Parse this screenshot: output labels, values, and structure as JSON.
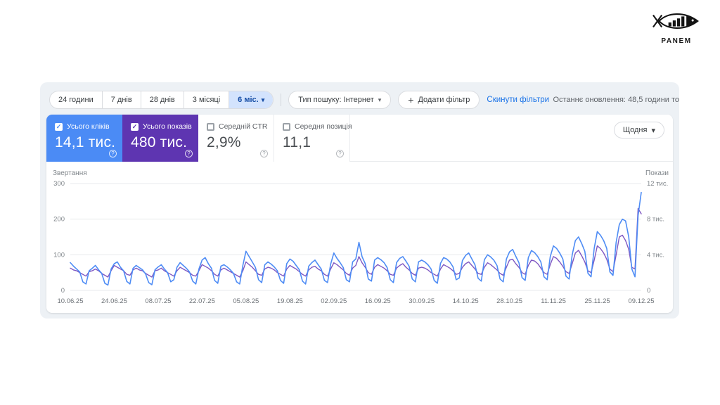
{
  "logo": {
    "brand": "PANEM"
  },
  "icons": {
    "chevron_down": "▾",
    "plus": "+",
    "check": "✓",
    "help": "?"
  },
  "toolbar": {
    "ranges": [
      {
        "label": "24 години",
        "selected": false
      },
      {
        "label": "7 днів",
        "selected": false
      },
      {
        "label": "28 днів",
        "selected": false
      },
      {
        "label": "3 місяці",
        "selected": false
      },
      {
        "label": "6 міс.",
        "selected": true
      }
    ],
    "search_type": "Тип пошуку: Інтернет",
    "add_filter": "Додати фільтр",
    "reset_filters": "Скинути фільтри",
    "last_update": "Останнє оновлення: 48,5 години то"
  },
  "metrics": {
    "granularity": "Щодня",
    "cards": [
      {
        "label": "Усього кліків",
        "value": "14,1 тис.",
        "checked": true,
        "color": "#4b8bf5"
      },
      {
        "label": "Усього показів",
        "value": "480 тис.",
        "checked": true,
        "color": "#5e35b1"
      },
      {
        "label": "Середній CTR",
        "value": "2,9%",
        "checked": false,
        "color": ""
      },
      {
        "label": "Середня позиція",
        "value": "11,1",
        "checked": false,
        "color": ""
      }
    ]
  },
  "chart_data": {
    "type": "line",
    "title": "",
    "grid": true,
    "legend_position": "none",
    "y_left": {
      "label": "Звертання",
      "ticks": [
        "300",
        "200",
        "100",
        "0"
      ],
      "max": 300
    },
    "y_right": {
      "label": "Покази",
      "ticks": [
        "12 тис.",
        "8 тис.",
        "4 тис.",
        "0"
      ],
      "max": 12
    },
    "x_tick_labels": [
      "10.06.25",
      "24.06.25",
      "08.07.25",
      "22.07.25",
      "05.08.25",
      "19.08.25",
      "02.09.25",
      "16.09.25",
      "30.09.25",
      "14.10.25",
      "28.10.25",
      "11.11.25",
      "25.11.25",
      "09.12.25"
    ],
    "series": [
      {
        "name": "Усього кліків",
        "axis": "left",
        "color": "#4e8cf5",
        "values": [
          78,
          68,
          60,
          52,
          24,
          18,
          55,
          62,
          70,
          58,
          48,
          20,
          15,
          60,
          75,
          80,
          65,
          55,
          25,
          18,
          62,
          70,
          64,
          58,
          46,
          22,
          16,
          58,
          66,
          72,
          60,
          50,
          24,
          30,
          65,
          78,
          70,
          62,
          52,
          26,
          18,
          60,
          85,
          92,
          75,
          62,
          28,
          20,
          68,
          72,
          66,
          58,
          48,
          24,
          18,
          70,
          110,
          95,
          80,
          65,
          30,
          22,
          72,
          80,
          74,
          66,
          55,
          28,
          20,
          75,
          88,
          82,
          70,
          58,
          26,
          18,
          68,
          78,
          85,
          72,
          60,
          28,
          22,
          74,
          105,
          90,
          78,
          64,
          30,
          24,
          80,
          88,
          135,
          95,
          75,
          32,
          26,
          85,
          92,
          86,
          78,
          64,
          30,
          22,
          78,
          90,
          95,
          82,
          68,
          32,
          24,
          80,
          85,
          80,
          72,
          60,
          28,
          20,
          76,
          92,
          88,
          80,
          66,
          30,
          35,
          84,
          98,
          105,
          88,
          72,
          34,
          26,
          86,
          100,
          94,
          85,
          70,
          32,
          24,
          88,
          108,
          115,
          96,
          78,
          36,
          28,
          92,
          112,
          106,
          95,
          80,
          38,
          30,
          95,
          125,
          118,
          105,
          88,
          40,
          32,
          100,
          140,
          150,
          132,
          110,
          48,
          38,
          118,
          165,
          155,
          140,
          118,
          52,
          42,
          135,
          185,
          200,
          195,
          150,
          60,
          38,
          210,
          275
        ]
      },
      {
        "name": "Усього показів (тис.)",
        "axis": "right",
        "color": "#7e57c2",
        "values": [
          2.5,
          2.3,
          2.2,
          2.0,
          1.8,
          1.6,
          2.1,
          2.2,
          2.4,
          2.2,
          1.9,
          1.7,
          1.5,
          2.2,
          2.8,
          2.6,
          2.4,
          2.2,
          1.8,
          1.7,
          2.3,
          2.5,
          2.3,
          2.2,
          1.9,
          1.7,
          1.5,
          2.2,
          2.3,
          2.5,
          2.2,
          2.0,
          1.8,
          1.6,
          2.2,
          2.6,
          2.4,
          2.2,
          2.0,
          1.7,
          1.6,
          2.2,
          2.9,
          2.7,
          2.5,
          2.2,
          1.8,
          1.6,
          2.3,
          2.5,
          2.3,
          2.1,
          1.9,
          1.7,
          1.5,
          2.2,
          3.2,
          2.9,
          2.6,
          2.2,
          1.8,
          1.7,
          2.4,
          2.6,
          2.5,
          2.3,
          2.0,
          1.8,
          1.6,
          2.4,
          2.8,
          2.6,
          2.4,
          2.1,
          1.8,
          1.6,
          2.3,
          2.6,
          2.7,
          2.4,
          2.2,
          1.8,
          1.6,
          2.4,
          3.1,
          2.9,
          2.6,
          2.3,
          1.9,
          1.7,
          2.5,
          2.8,
          3.8,
          3.1,
          2.6,
          2.0,
          1.8,
          2.6,
          2.9,
          2.7,
          2.5,
          2.2,
          1.8,
          1.7,
          2.5,
          2.8,
          3.0,
          2.6,
          2.3,
          1.9,
          1.7,
          2.5,
          2.6,
          2.5,
          2.3,
          2.0,
          1.8,
          1.6,
          2.4,
          2.9,
          2.7,
          2.5,
          2.2,
          1.8,
          1.9,
          2.6,
          3.0,
          3.2,
          2.8,
          2.4,
          1.9,
          1.8,
          2.6,
          3.1,
          2.9,
          2.6,
          2.3,
          1.9,
          1.7,
          2.6,
          3.4,
          3.5,
          3.0,
          2.6,
          2.0,
          1.8,
          2.8,
          3.4,
          3.3,
          3.0,
          2.5,
          2.0,
          1.8,
          2.9,
          3.8,
          3.6,
          3.2,
          2.7,
          2.1,
          1.9,
          3.0,
          4.2,
          4.5,
          3.9,
          3.2,
          2.2,
          2.0,
          3.4,
          5.0,
          4.7,
          4.2,
          3.5,
          2.4,
          2.1,
          4.0,
          6.0,
          6.2,
          5.6,
          4.6,
          2.6,
          2.4,
          9.2,
          8.6
        ]
      }
    ]
  }
}
